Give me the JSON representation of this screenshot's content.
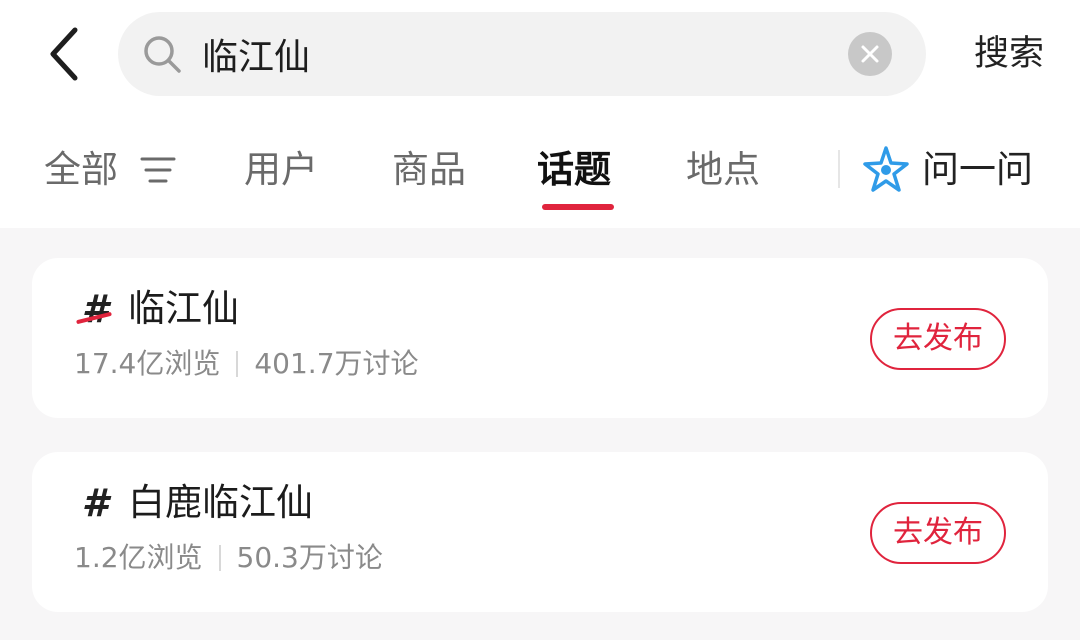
{
  "search": {
    "query": "临江仙",
    "submit_label": "搜索",
    "icons": {
      "back": "chevron-left-icon",
      "search": "search-icon",
      "clear": "close-icon"
    }
  },
  "tabs": [
    {
      "label": "全部",
      "active": false,
      "icon": "filter-icon"
    },
    {
      "label": "用户",
      "active": false
    },
    {
      "label": "商品",
      "active": false
    },
    {
      "label": "话题",
      "active": true
    },
    {
      "label": "地点",
      "active": false
    }
  ],
  "ask": {
    "label": "问一问",
    "icon": "star-sparkle-icon"
  },
  "colors": {
    "accent": "#e0243d",
    "ask_icon": "#2f9be8"
  },
  "topics": [
    {
      "title": "临江仙",
      "views": "17.4亿浏览",
      "discussions": "401.7万讨论",
      "publish_label": "去发布",
      "icon": "hashtag-icon"
    },
    {
      "title": "白鹿临江仙",
      "views": "1.2亿浏览",
      "discussions": "50.3万讨论",
      "publish_label": "去发布",
      "icon": "hashtag-icon"
    }
  ]
}
